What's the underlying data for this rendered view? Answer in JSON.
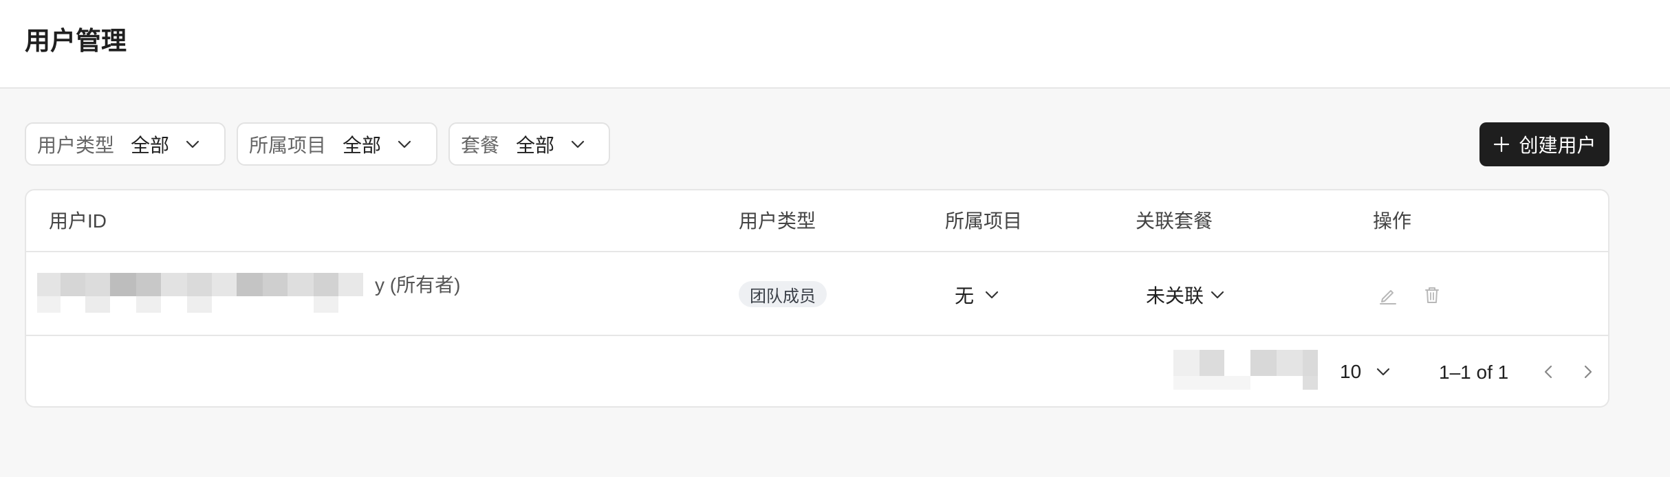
{
  "header": {
    "title": "用户管理"
  },
  "filters": [
    {
      "label": "用户类型",
      "value": "全部",
      "icon": "chevron-down-icon"
    },
    {
      "label": "所属项目",
      "value": "全部",
      "icon": "chevron-down-icon"
    },
    {
      "label": "套餐",
      "value": "全部",
      "icon": "chevron-down-icon"
    }
  ],
  "create_button": {
    "label": "创建用户",
    "icon": "plus-icon"
  },
  "table": {
    "columns": [
      "用户ID",
      "用户类型",
      "所属项目",
      "关联套餐",
      "操作"
    ],
    "rows": [
      {
        "user_id_suffix": "y (所有者)",
        "user_type": "团队成员",
        "project": "无",
        "plan": "未关联",
        "actions": [
          "edit-icon",
          "trash-icon"
        ]
      }
    ]
  },
  "pagination": {
    "per_page": "10",
    "range": "1–1 of 1",
    "prev_icon": "chevron-left-icon",
    "next_icon": "chevron-right-icon"
  },
  "colors": {
    "background": "#f7f7f7",
    "surface": "#ffffff",
    "border": "#e6e6e6",
    "primary_button": "#1e1e1e",
    "badge_bg": "#eef0f3"
  }
}
